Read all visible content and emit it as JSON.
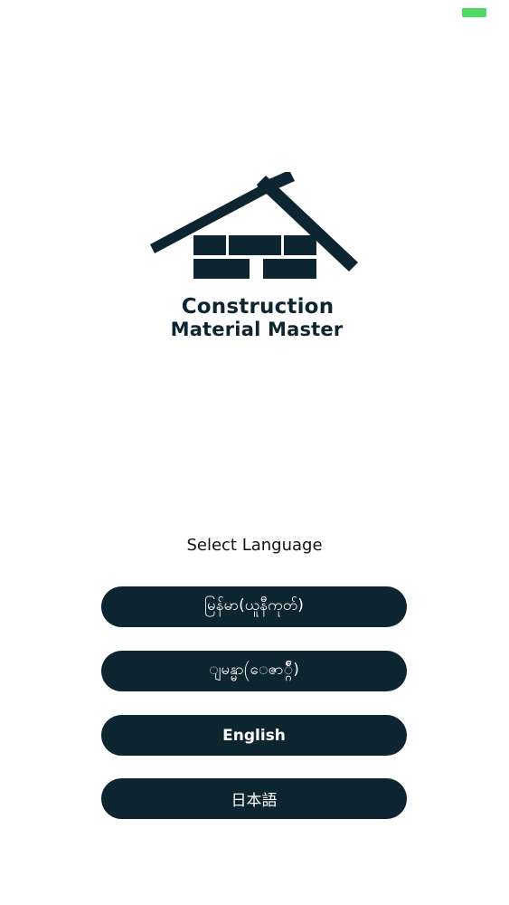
{
  "status_bar": {
    "battery_color": "#4cd964"
  },
  "logo": {
    "line1": "Construction",
    "line2": "Material Master",
    "brand_color": "#0d2530"
  },
  "language_select": {
    "title": "Select Language",
    "options": [
      {
        "label": "မြန်မာ(ယူနီကုတ်)"
      },
      {
        "label": "ျမန္မာ(ေဇာ္ဂ်ီ)"
      },
      {
        "label": "English"
      },
      {
        "label": "日本語"
      }
    ]
  },
  "colors": {
    "button_bg": "#0d2530",
    "button_text": "#ffffff"
  }
}
